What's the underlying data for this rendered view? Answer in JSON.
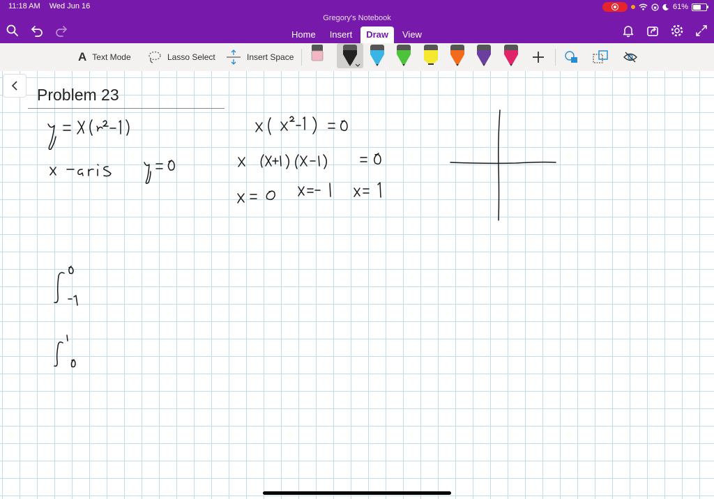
{
  "status": {
    "time": "11:18 AM",
    "date": "Wed Jun 16",
    "battery": "61%"
  },
  "notebook_title": "Gregory's Notebook",
  "tabs": [
    {
      "label": "Home"
    },
    {
      "label": "Insert"
    },
    {
      "label": "Draw"
    },
    {
      "label": "View"
    }
  ],
  "ribbon": {
    "text_mode": "Text Mode",
    "lasso_select": "Lasso Select",
    "insert_space": "Insert Space",
    "text_mode_glyph": "A",
    "pens": [
      {
        "name": "black-pen",
        "color": "#222222"
      },
      {
        "name": "cyan-pen",
        "color": "#3ab4e6"
      },
      {
        "name": "green-pen",
        "color": "#4cc33a"
      },
      {
        "name": "yellow-highlighter",
        "color": "#f5e830"
      },
      {
        "name": "orange-pen",
        "color": "#f26b1d"
      },
      {
        "name": "purple-pen",
        "color": "#6b3fa0"
      },
      {
        "name": "pink-pen",
        "color": "#e0246a"
      }
    ]
  },
  "page": {
    "title": "Problem 23"
  },
  "colors": {
    "brand": "#7719aa",
    "grid": "#c4dde9",
    "ink": "#1a1a1a"
  }
}
